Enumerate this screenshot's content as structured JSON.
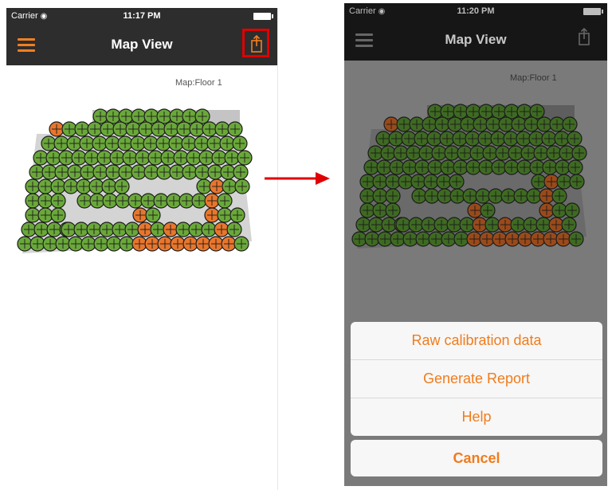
{
  "left_screen": {
    "status_bar": {
      "carrier": "Carrier",
      "time": "11:17 PM"
    },
    "navbar": {
      "title": "Map View",
      "menu_icon": "hamburger-icon",
      "share_icon": "share-icon"
    },
    "map_label": "Map:Floor 1"
  },
  "right_screen": {
    "status_bar": {
      "carrier": "Carrier",
      "time": "11:20 PM"
    },
    "navbar": {
      "title": "Map View",
      "menu_icon": "hamburger-icon",
      "share_icon": "share-icon"
    },
    "map_label": "Map:Floor 1",
    "action_sheet": {
      "items": [
        "Raw calibration data",
        "Generate Report",
        "Help"
      ],
      "cancel": "Cancel"
    }
  },
  "colors": {
    "accent": "#f07c1d",
    "highlight": "#e00000",
    "marker_green": "#6aa83a",
    "marker_orange": "#e8762d",
    "navbar_dark": "#2d2d2d"
  }
}
